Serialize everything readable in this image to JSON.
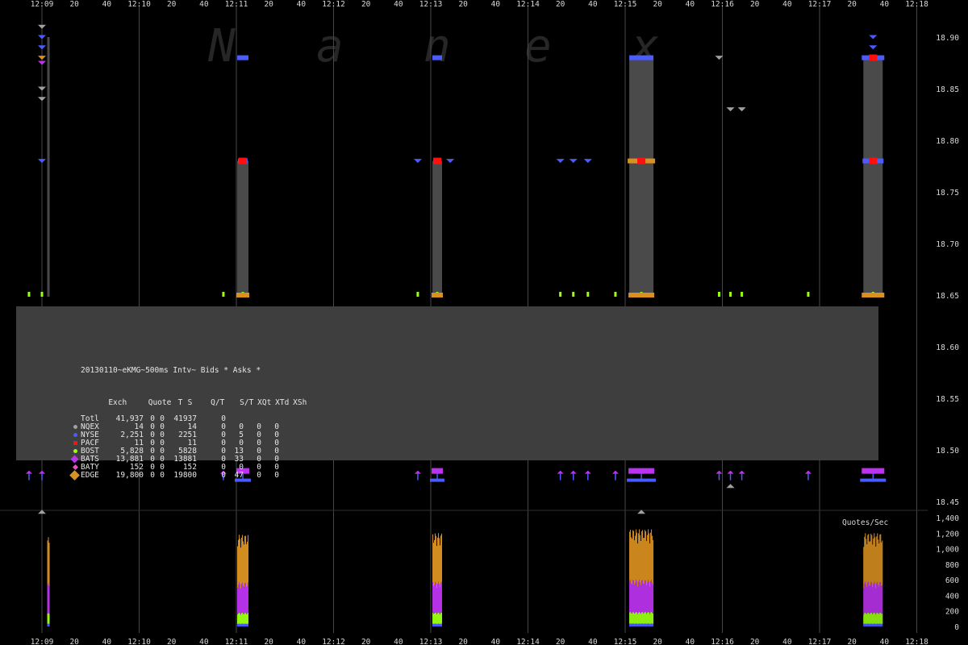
{
  "chart_data": {
    "type": "scatter",
    "watermark": "Nanex",
    "x_axis": {
      "major_labels": [
        "12:09",
        "12:10",
        "12:11",
        "12:12",
        "12:13",
        "12:14",
        "12:15",
        "12:16",
        "12:17",
        "12:18"
      ],
      "minor_labels": [
        "20",
        "40"
      ]
    },
    "price_axis": {
      "ticks": [
        "18.90",
        "18.85",
        "18.80",
        "18.75",
        "18.70",
        "18.65",
        "18.60",
        "18.55",
        "18.50",
        "18.45"
      ],
      "range": [
        18.44,
        18.92
      ]
    },
    "quotes_panel": {
      "title": "Quotes/Sec",
      "ticks": [
        "1,400",
        "1,200",
        "1,000",
        "800",
        "600",
        "400",
        "200",
        "0"
      ],
      "range": [
        0,
        1400
      ],
      "bursts": [
        {
          "time": "12:09:04",
          "peak": 1150
        },
        {
          "time": "12:11:04",
          "peak": 1180
        },
        {
          "time": "12:13:04",
          "peak": 1200
        },
        {
          "time": "12:15:10",
          "peak": 1250
        },
        {
          "time": "12:17:33",
          "peak": 1200
        }
      ]
    },
    "ask_levels": [
      18.9,
      18.88,
      18.85,
      18.78
    ],
    "bid_levels": [
      18.65,
      18.48
    ],
    "series": [
      {
        "name": "NQEX",
        "color": "#a0a0a0",
        "marker": "circle"
      },
      {
        "name": "NYSE",
        "color": "#4a5cff",
        "marker": "circle"
      },
      {
        "name": "PACF",
        "color": "#ff1010",
        "marker": "square"
      },
      {
        "name": "BOST",
        "color": "#99ff11",
        "marker": "circle"
      },
      {
        "name": "BATS",
        "color": "#bb33ee",
        "marker": "diamond"
      },
      {
        "name": "BATY",
        "color": "#ff44cc",
        "marker": "diamond"
      },
      {
        "name": "EDGE",
        "color": "#d99020",
        "marker": "diamond"
      }
    ]
  },
  "legend": {
    "title": "20130110~eKMG~500ms Intv~ Bids * Asks *",
    "header": [
      "Exch",
      "Quote",
      "T",
      "S",
      "Q/T",
      "S/T",
      "XQt",
      "XTd",
      "XSh"
    ],
    "rows": [
      [
        "Totl",
        "41,937",
        "0",
        "0",
        "41937",
        "0",
        "",
        "",
        ""
      ],
      [
        "NQEX",
        "14",
        "0",
        "0",
        "14",
        "0",
        "0",
        "0",
        "0"
      ],
      [
        "NYSE",
        "2,251",
        "0",
        "0",
        "2251",
        "0",
        "5",
        "0",
        "0"
      ],
      [
        "PACF",
        "11",
        "0",
        "0",
        "11",
        "0",
        "0",
        "0",
        "0"
      ],
      [
        "BOST",
        "5,828",
        "0",
        "0",
        "5828",
        "0",
        "13",
        "0",
        "0"
      ],
      [
        "BATS",
        "13,881",
        "0",
        "0",
        "13881",
        "0",
        "33",
        "0",
        "0"
      ],
      [
        "BATY",
        "152",
        "0",
        "0",
        "152",
        "0",
        "0",
        "0",
        "0"
      ],
      [
        "EDGE",
        "19,800",
        "0",
        "0",
        "19800",
        "0",
        "47",
        "0",
        "0"
      ]
    ]
  }
}
